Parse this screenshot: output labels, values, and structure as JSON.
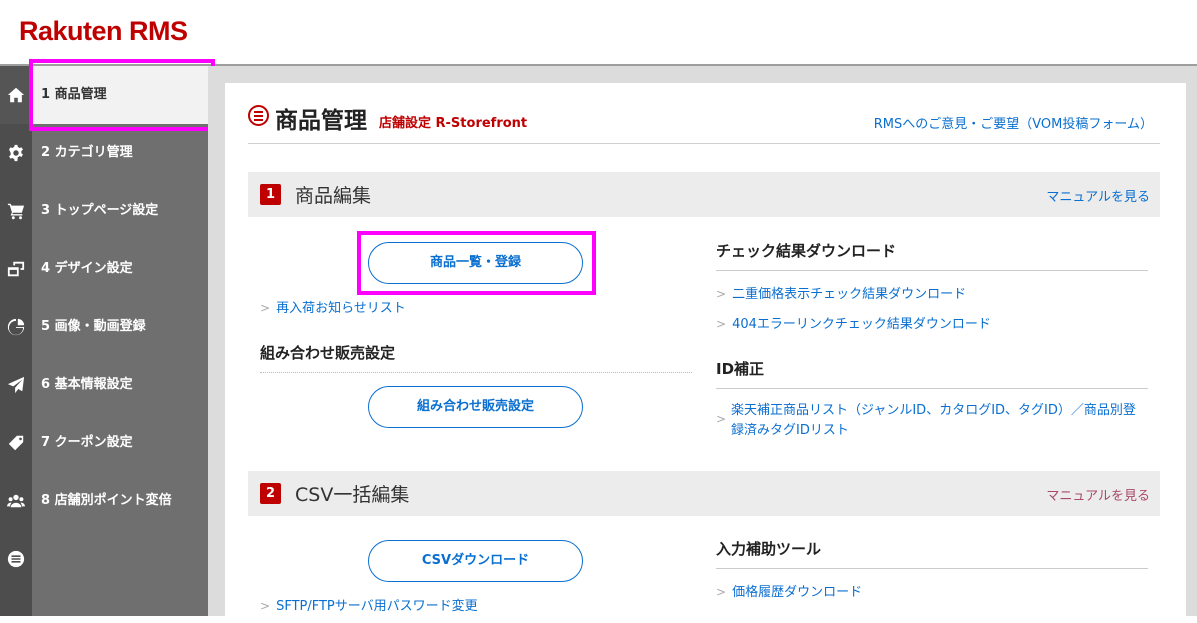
{
  "header": {
    "logo": "Rakuten RMS"
  },
  "sidebar": {
    "items": [
      {
        "label": "1  商品管理",
        "icon": "home-icon"
      },
      {
        "label": "2  カテゴリ管理",
        "icon": "gear-icon"
      },
      {
        "label": "3  トップページ設定",
        "icon": "cart-icon"
      },
      {
        "label": "4  デザイン設定",
        "icon": "windows-icon"
      },
      {
        "label": "5  画像・動画登録",
        "icon": "pie-chart-icon"
      },
      {
        "label": "6  基本情報設定",
        "icon": "paper-plane-icon"
      },
      {
        "label": "7  クーポン設定",
        "icon": "tag-icon"
      },
      {
        "label": "8  店舗別ポイント変倍",
        "icon": "users-icon"
      },
      {
        "label": "",
        "icon": "list-circle-icon"
      }
    ]
  },
  "page": {
    "title": "商品管理",
    "subtitle": "店舗設定 R-Storefront",
    "feedback_link": "RMSへのご意見・ご要望（VOM投稿フォーム）"
  },
  "sections": [
    {
      "number": "1",
      "title": "商品編集",
      "manual": "マニュアルを見る",
      "button_list": "商品一覧・登録",
      "link_restock": "再入荷お知らせリスト",
      "sub_combo": "組み合わせ販売設定",
      "button_combo": "組み合わせ販売設定",
      "sub_check": "チェック結果ダウンロード",
      "link_double_price": "二重価格表示チェック結果ダウンロード",
      "link_404": "404エラーリンクチェック結果ダウンロード",
      "sub_id": "ID補正",
      "link_id_fix": "楽天補正商品リスト（ジャンルID、カタログID、タグID）／商品別登録済みタグIDリスト"
    },
    {
      "number": "2",
      "title": "CSV一括編集",
      "manual": "マニュアルを見る",
      "button_csv": "CSVダウンロード",
      "link_sftp": "SFTP/FTPサーバ用パスワード変更",
      "sub_tools": "入力補助ツール",
      "link_price_history": "価格履歴ダウンロード"
    }
  ],
  "colors": {
    "brand": "#bf0000",
    "link": "#0a6fd0",
    "highlight": "#ff00ff"
  }
}
